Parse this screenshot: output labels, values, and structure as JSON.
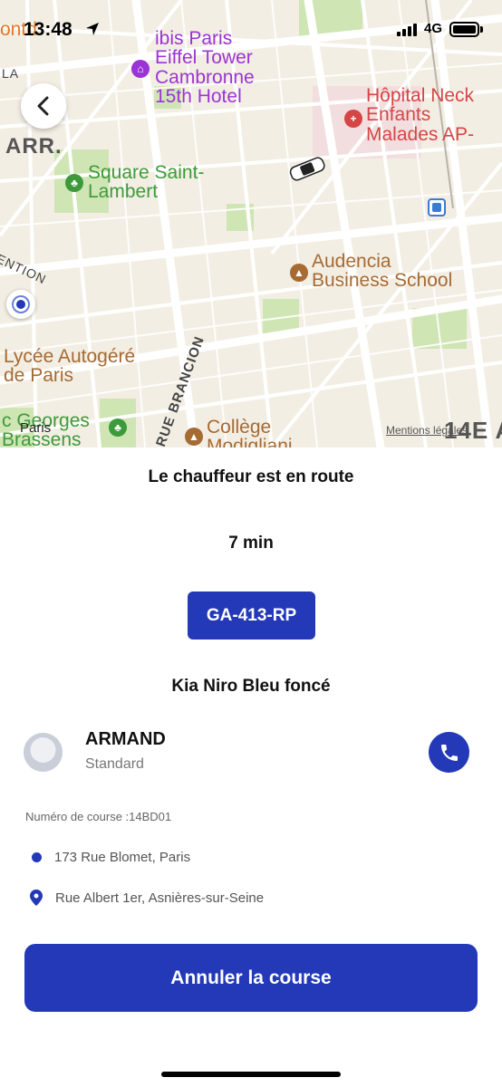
{
  "status_bar": {
    "time": "13:48",
    "network": "4G",
    "icons": [
      "location-arrow-icon",
      "signal-icon",
      "battery-icon"
    ]
  },
  "map": {
    "labels": {
      "top_left_fragment": "ontd",
      "la": "LA",
      "arr": "ARR.",
      "ibis": [
        "ibis Paris",
        "Eiffel Tower",
        "Cambronne",
        "15th Hotel"
      ],
      "hopital": [
        "Hôpital Neck",
        "Enfants",
        "Malades AP-"
      ],
      "square": [
        "Square Saint-",
        "Lambert"
      ],
      "audencia": [
        "Audencia",
        "Business School"
      ],
      "lycee": [
        "Lycée Autogéré",
        "de Paris"
      ],
      "college": [
        "Collège",
        "Modigliani"
      ],
      "georges": [
        "c Georges",
        "Brassens"
      ],
      "paris_small": "Paris",
      "rue_brancion": "RUE BRANCION",
      "convention": "ENTION",
      "arr_14": "14E A"
    },
    "legal_link": "Mentions légales",
    "colors": {
      "background": "#f3eee3",
      "park": "#cfe5b4",
      "road": "#ffffff",
      "purple_poi": "#9b34d6",
      "green_poi": "#3d9a3a",
      "brown_poi": "#a66a33",
      "red_poi": "#d64545"
    }
  },
  "sheet": {
    "title": "Le chauffeur est en route",
    "eta": "7 min",
    "plate": "GA-413-RP",
    "vehicle": "Kia Niro Bleu foncé",
    "driver": {
      "name": "ARMAND",
      "category": "Standard"
    },
    "ride_number": "Numéro de course :14BD01",
    "pickup": "173 Rue Blomet, Paris",
    "destination": "Rue Albert 1er, Asnières-sur-Seine",
    "cancel_label": "Annuler la course",
    "accent_color": "#2339b8"
  }
}
